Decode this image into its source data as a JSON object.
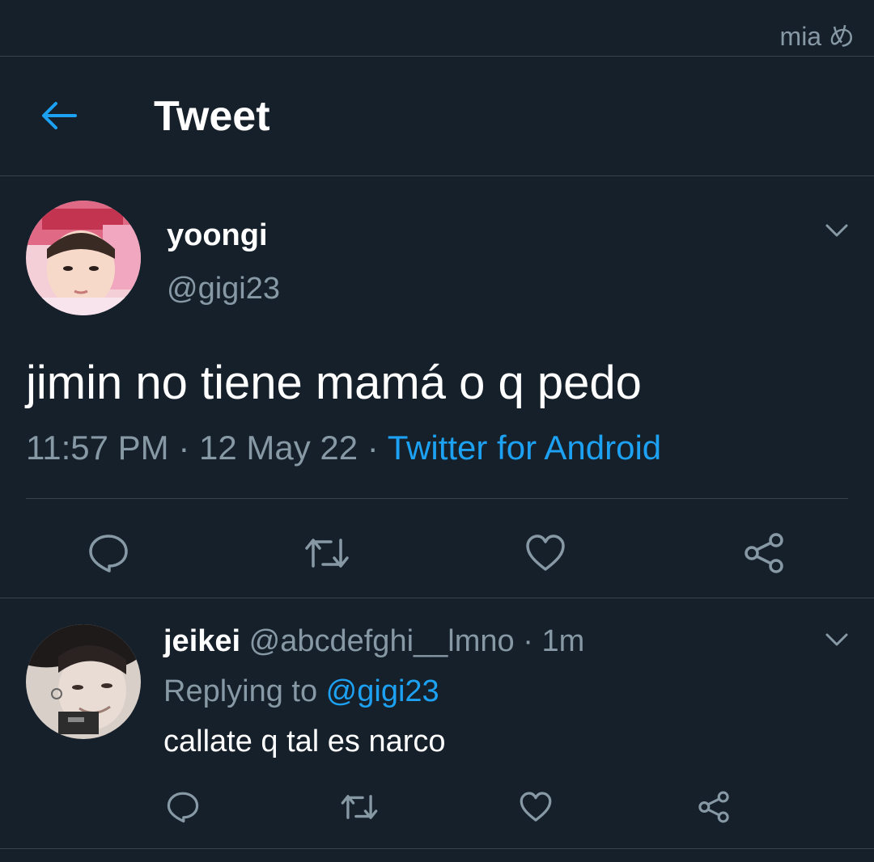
{
  "watermark": "mia め",
  "header": {
    "title": "Tweet"
  },
  "tweet": {
    "name": "yoongi",
    "handle": "@gigi23",
    "text": "jimin no tiene mamá o q pedo",
    "time": "11:57 PM",
    "date": "12 May 22",
    "source": "Twitter for Android",
    "separator": " · "
  },
  "reply": {
    "name": "jeikei",
    "handle": "@abcdefghi__lmno",
    "age": "1m",
    "separator": " · ",
    "replying_prefix": "Replying to ",
    "replying_to": "@gigi23",
    "text": "callate q tal es narco"
  },
  "icons": [
    "back-arrow-icon",
    "chevron-down-icon",
    "reply-icon",
    "retweet-icon",
    "like-icon",
    "share-icon"
  ],
  "colors": {
    "background": "#15202b",
    "accent": "#1da1f2",
    "secondary_text": "#8899a6",
    "divider": "#38444d"
  }
}
